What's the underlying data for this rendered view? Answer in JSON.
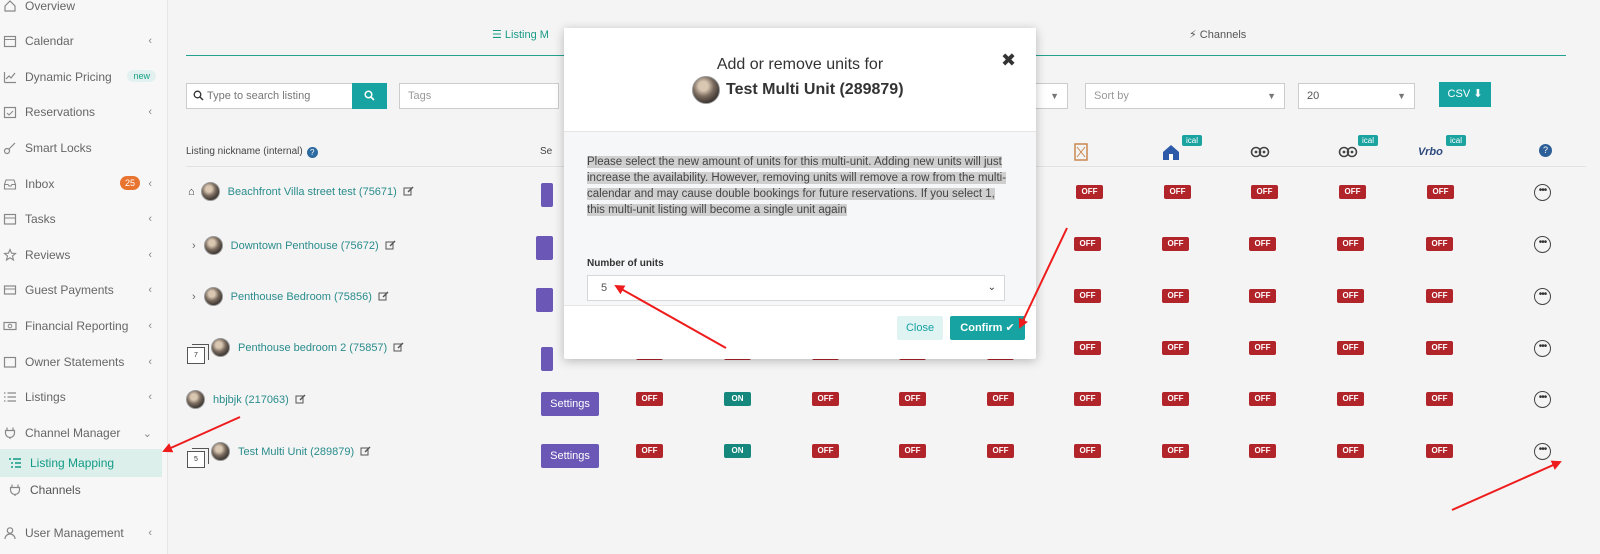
{
  "sidebar": {
    "items": [
      {
        "label": "Overview",
        "icon": "home-icon",
        "chevron": ""
      },
      {
        "label": "Calendar",
        "icon": "calendar-icon",
        "chevron": "‹"
      },
      {
        "label": "Dynamic Pricing",
        "icon": "chart-icon",
        "badge": "new"
      },
      {
        "label": "Reservations",
        "icon": "calendar-check-icon",
        "chevron": "‹"
      },
      {
        "label": "Smart Locks",
        "icon": "key-icon",
        "chevron": ""
      },
      {
        "label": "Inbox",
        "icon": "inbox-icon",
        "count": "25",
        "chevron": "‹"
      },
      {
        "label": "Tasks",
        "icon": "tasks-icon",
        "chevron": "‹"
      },
      {
        "label": "Reviews",
        "icon": "star-icon",
        "chevron": "‹"
      },
      {
        "label": "Guest Payments",
        "icon": "credit-card-icon",
        "chevron": "‹"
      },
      {
        "label": "Financial Reporting",
        "icon": "money-icon",
        "chevron": "‹"
      },
      {
        "label": "Owner Statements",
        "icon": "document-icon",
        "chevron": "‹"
      },
      {
        "label": "Listings",
        "icon": "list-icon",
        "chevron": "‹"
      },
      {
        "label": "Channel Manager",
        "icon": "plug-icon",
        "chevron": "⌄"
      },
      {
        "label": "User Management",
        "icon": "user-icon",
        "chevron": "‹"
      }
    ],
    "sub_items": [
      {
        "label": "Listing Mapping",
        "icon": "list-mapping-icon"
      },
      {
        "label": "Channels",
        "icon": "plug-icon"
      }
    ]
  },
  "tabs": {
    "listing_mapping": "Listing M",
    "channels": "Channels"
  },
  "filters": {
    "search_placeholder": "Type to search listing",
    "tags_placeholder": "Tags",
    "sort_placeholder": "Sort by",
    "page_size": "20",
    "csv_label": "CSV"
  },
  "table": {
    "header_nickname": "Listing nickname (internal)",
    "header_settings": "Se",
    "ical_label": "ical",
    "vrbo_label": "Vrbo",
    "settings_label": "Settings",
    "on_label": "ON",
    "off_label": "OFF",
    "more_label": "•••",
    "rows": [
      {
        "name": "Beachfront Villa street test (75671)",
        "prefix": "⌂"
      },
      {
        "name": "Downtown Penthouse (75672)",
        "prefix": "›"
      },
      {
        "name": "Penthouse Bedroom (75856)",
        "prefix": "›"
      },
      {
        "name": "Penthouse bedroom 2 (75857)",
        "units": "7"
      },
      {
        "name": "hbjbjk (217063)"
      },
      {
        "name": "Test Multi Unit (289879)",
        "units": "5"
      }
    ]
  },
  "modal": {
    "title": "Add or remove units for",
    "subtitle": "Test Multi Unit (289879)",
    "close_x": "✖",
    "message": "Please select the new amount of units for this multi-unit. Adding new units will just increase the availability. However, removing units will remove a row from the multi-calendar and may cause double bookings for future reservations. If you select 1, this multi-unit listing will become a single unit again",
    "units_label": "Number of units",
    "units_value": "5",
    "close_label": "Close",
    "confirm_label": "Confirm ✔"
  },
  "colors": {
    "accent": "#16a3a1",
    "off": "#b0242a",
    "on": "#15877c",
    "settings": "#6b57b6",
    "annotation_arrow": "#ee1c1c"
  }
}
